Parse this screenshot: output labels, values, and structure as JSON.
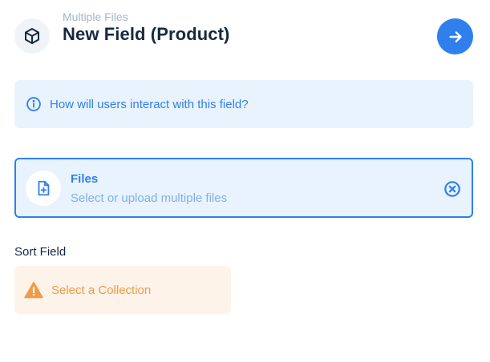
{
  "header": {
    "subtitle": "Multiple Files",
    "title": "New Field (Product)",
    "icon": "box-icon",
    "next_icon": "arrow-right-icon"
  },
  "notice": {
    "icon": "info-icon",
    "text": "How will users interact with this field?"
  },
  "interface_option": {
    "icon": "file-add-icon",
    "title": "Files",
    "description": "Select or upload multiple files",
    "deselect_icon": "close-circle-icon",
    "selected": true
  },
  "sort_field": {
    "label": "Sort Field",
    "warning_icon": "warning-icon",
    "warning_text": "Select a Collection"
  },
  "colors": {
    "primary": "#2f80ed",
    "primary_bg": "#e9f3fd",
    "warning": "#f2994a",
    "warning_bg": "#fef3e8",
    "text": "#172940",
    "subdued": "#a2b5cd"
  }
}
